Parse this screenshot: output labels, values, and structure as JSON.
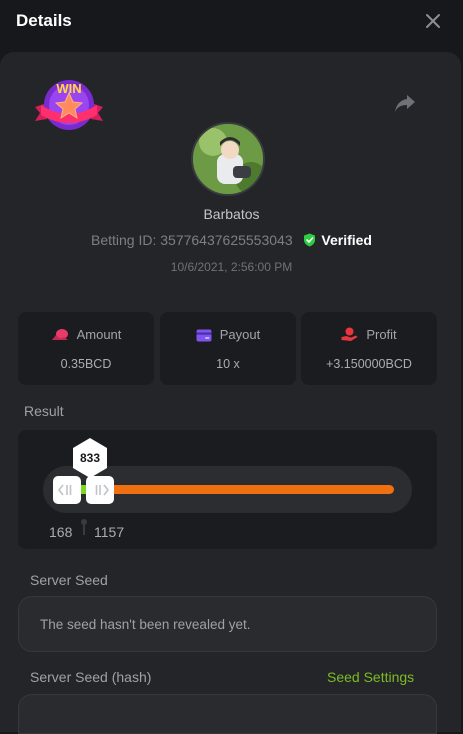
{
  "header": {
    "title": "Details"
  },
  "bet": {
    "badge_text": "WIN",
    "username": "Barbatos",
    "betting_id_label": "Betting ID:",
    "betting_id": "35776437625553043",
    "verified_label": "Verified",
    "datetime": "10/6/2021, 2:56:00 PM"
  },
  "stats": [
    {
      "label": "Amount",
      "value": "0.35BCD",
      "icon": "coins-icon",
      "color": "#e83b6a"
    },
    {
      "label": "Payout",
      "value": "10 x",
      "icon": "card-icon",
      "color": "#7f55f0"
    },
    {
      "label": "Profit",
      "value": "+3.150000BCD",
      "icon": "hand-coin-icon",
      "color": "#e8363e"
    }
  ],
  "result": {
    "label": "Result",
    "value": "833",
    "low": "168",
    "high": "1157"
  },
  "server_seed": {
    "label": "Server Seed",
    "text": "The seed hasn't been revealed yet."
  },
  "server_seed_hash": {
    "label": "Server Seed (hash)",
    "settings_link": "Seed Settings"
  },
  "colors": {
    "accent_green": "#7dbb25",
    "win_orange": "#f06f11",
    "verified_green": "#2ecc40"
  }
}
